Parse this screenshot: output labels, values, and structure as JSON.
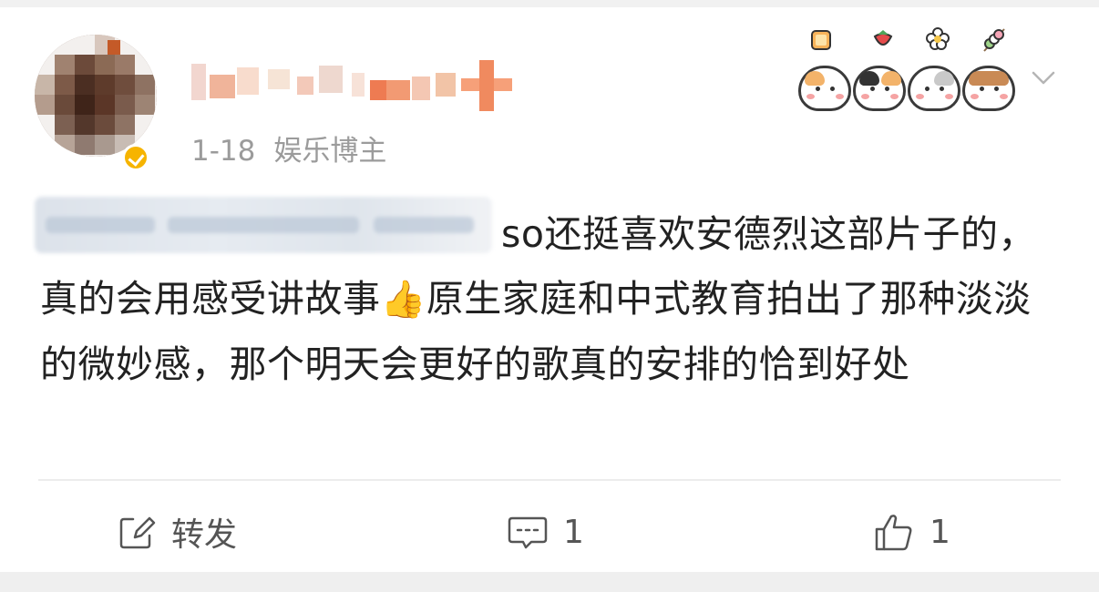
{
  "post": {
    "time": "1-18",
    "user_tag": "娱乐博主",
    "body_lead": "so",
    "body": "so还挺喜欢安德烈这部片子的，真的会用感受讲故事👍原生家庭和中式教育拍出了那种淡淡的微妙感，那个明天会更好的歌真的安排的恰到好处",
    "body_before_emoji": "so还挺喜欢安德烈这部片子的，真的会用感受讲故事",
    "emoji": "👍",
    "body_after_emoji": "原生家庭和中式教育拍出了那种淡淡的微妙感，那个明天会更好的歌真的安排的恰到好处"
  },
  "actions": {
    "repost_label": "转发",
    "comment_count": "1",
    "like_count": "1"
  },
  "icons": {
    "repost": "share-edit-icon",
    "comment": "comment-bubble-icon",
    "like": "thumbs-up-icon",
    "menu": "chevron-down-icon",
    "verified": "verified-badge-icon"
  },
  "colors": {
    "text": "#222222",
    "meta": "#9b9b9b",
    "verified": "#f6b400",
    "divider": "#ececec"
  }
}
